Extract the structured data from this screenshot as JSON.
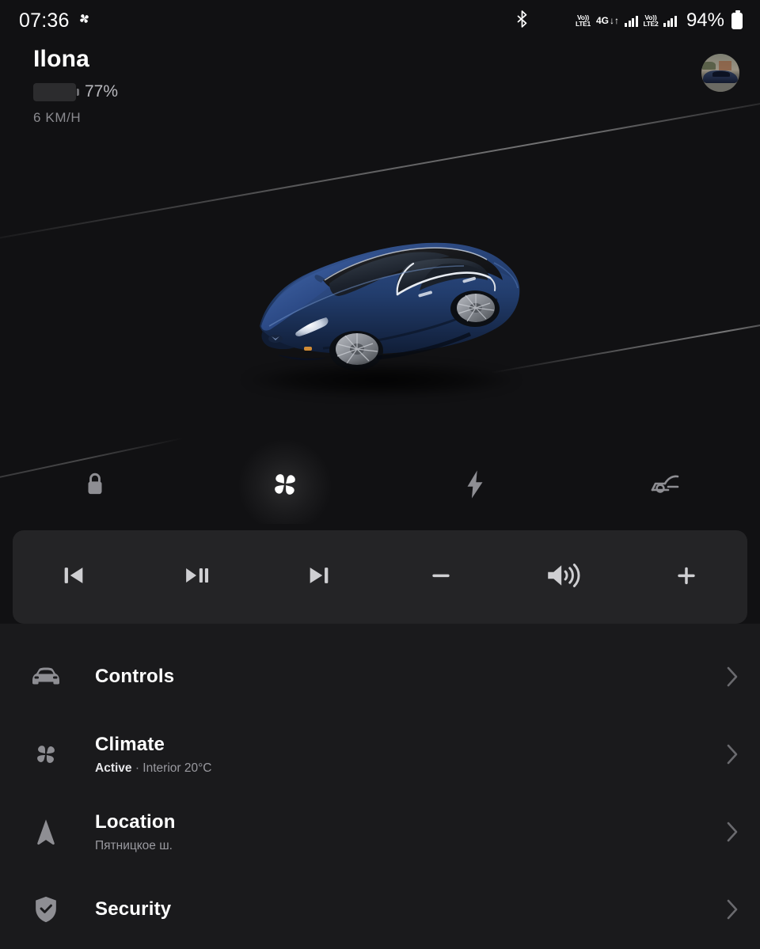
{
  "statusbar": {
    "clock": "07:36",
    "clock_icon": "fan-icon",
    "bluetooth_icon": "bluetooth-icon",
    "sim1": {
      "volte_top": "Vo))",
      "volte_bottom": "LTE1"
    },
    "network": {
      "generation": "4G",
      "data_arrows": "↓↑"
    },
    "sim2": {
      "volte_top": "Vo))",
      "volte_bottom": "LTE2"
    },
    "battery_percent": "94%"
  },
  "vehicle": {
    "name": "Ilona",
    "battery_percent_label": "77%",
    "battery_percent_value": 77,
    "speed": "6 KM/H",
    "avatar_name": "vehicle-photo-avatar",
    "image_alt": "blue-tesla-model-s"
  },
  "quick_actions": [
    {
      "name": "lock-button",
      "icon": "lock-icon",
      "active": false
    },
    {
      "name": "climate-button",
      "icon": "fan-icon",
      "active": true
    },
    {
      "name": "charging-button",
      "icon": "bolt-icon",
      "active": false
    },
    {
      "name": "frunk-button",
      "icon": "frunk-icon",
      "active": false
    }
  ],
  "media": [
    {
      "name": "previous-track-button",
      "icon": "skip-previous-icon"
    },
    {
      "name": "play-pause-button",
      "icon": "play-pause-icon"
    },
    {
      "name": "next-track-button",
      "icon": "skip-next-icon"
    },
    {
      "name": "volume-down-button",
      "icon": "minus-icon"
    },
    {
      "name": "speaker-button",
      "icon": "volume-icon"
    },
    {
      "name": "volume-up-button",
      "icon": "plus-icon"
    }
  ],
  "menu": [
    {
      "title": "Controls",
      "subtitle": "",
      "subtitle_bold": "",
      "icon": "car-front-icon"
    },
    {
      "title": "Climate",
      "subtitle": " · Interior 20°C",
      "subtitle_bold": "Active",
      "icon": "fan-icon"
    },
    {
      "title": "Location",
      "subtitle": "Пятницкое ш.",
      "subtitle_bold": "",
      "icon": "navigation-arrow-icon"
    },
    {
      "title": "Security",
      "subtitle": "",
      "subtitle_bold": "",
      "icon": "shield-check-icon"
    }
  ],
  "colors": {
    "background": "#111113",
    "list_background": "#1a1a1c",
    "media_background": "#242426",
    "text_primary": "#ffffff",
    "text_secondary": "#9a9aa0",
    "icon_inactive": "#8e8e93",
    "icon_active": "#ffffff",
    "car_blue": "#27406e"
  }
}
